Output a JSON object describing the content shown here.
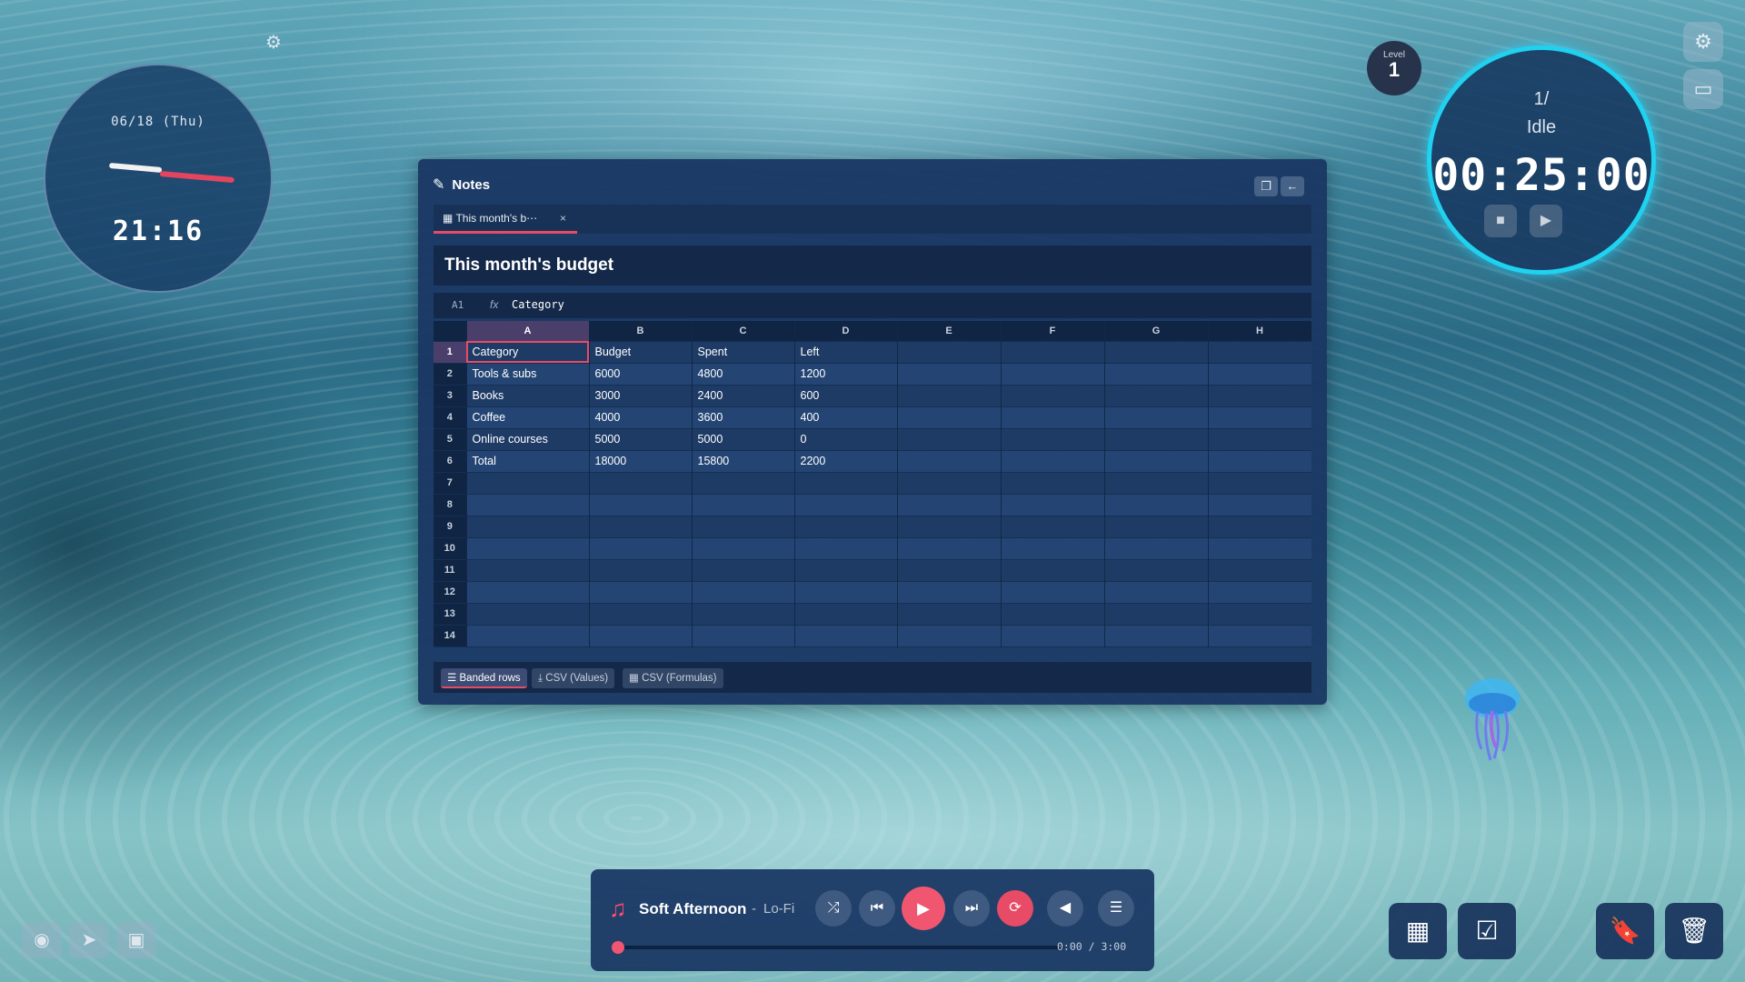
{
  "clock": {
    "date": "06/18 (Thu)",
    "time": "21:16"
  },
  "level": {
    "label": "Level",
    "value": "1"
  },
  "timer": {
    "count": "1/",
    "status": "Idle",
    "time": "00:25:00"
  },
  "notes": {
    "title": "Notes",
    "tab_label": "This month's b⋯",
    "tab_close": "×",
    "doc_title": "This month's budget",
    "formula_bar": {
      "cell_ref": "A1",
      "fx": "fx",
      "value": "Category"
    },
    "columns": [
      "A",
      "B",
      "C",
      "D",
      "E",
      "F",
      "G",
      "H"
    ],
    "rows": [
      {
        "num": "1",
        "cells": [
          "Category",
          "Budget",
          "Spent",
          "Left",
          "",
          "",
          "",
          ""
        ]
      },
      {
        "num": "2",
        "cells": [
          "Tools & subs",
          "6000",
          "4800",
          "1200",
          "",
          "",
          "",
          ""
        ]
      },
      {
        "num": "3",
        "cells": [
          "Books",
          "3000",
          "2400",
          "600",
          "",
          "",
          "",
          ""
        ]
      },
      {
        "num": "4",
        "cells": [
          "Coffee",
          "4000",
          "3600",
          "400",
          "",
          "",
          "",
          ""
        ]
      },
      {
        "num": "5",
        "cells": [
          "Online courses",
          "5000",
          "5000",
          "0",
          "",
          "",
          "",
          ""
        ]
      },
      {
        "num": "6",
        "cells": [
          "Total",
          "18000",
          "15800",
          "2200",
          "",
          "",
          "",
          ""
        ]
      },
      {
        "num": "7",
        "cells": [
          "",
          "",
          "",
          "",
          "",
          "",
          "",
          ""
        ]
      },
      {
        "num": "8",
        "cells": [
          "",
          "",
          "",
          "",
          "",
          "",
          "",
          ""
        ]
      },
      {
        "num": "9",
        "cells": [
          "",
          "",
          "",
          "",
          "",
          "",
          "",
          ""
        ]
      },
      {
        "num": "10",
        "cells": [
          "",
          "",
          "",
          "",
          "",
          "",
          "",
          ""
        ]
      },
      {
        "num": "11",
        "cells": [
          "",
          "",
          "",
          "",
          "",
          "",
          "",
          ""
        ]
      },
      {
        "num": "12",
        "cells": [
          "",
          "",
          "",
          "",
          "",
          "",
          "",
          ""
        ]
      },
      {
        "num": "13",
        "cells": [
          "",
          "",
          "",
          "",
          "",
          "",
          "",
          ""
        ]
      },
      {
        "num": "14",
        "cells": [
          "",
          "",
          "",
          "",
          "",
          "",
          "",
          ""
        ]
      }
    ],
    "footer": {
      "banded": "Banded rows",
      "csv_values": "CSV (Values)",
      "csv_formulas": "CSV (Formulas)"
    }
  },
  "player": {
    "title": "Soft Afternoon",
    "separator": "-",
    "genre": "Lo-Fi",
    "time": "0:00 / 3:00",
    "progress": 0
  },
  "colors": {
    "accent": "#e84b65",
    "timer_ring": "#1fd2f0",
    "panel": "#1a3864"
  },
  "icons": [
    "gear-icon",
    "pencil-icon",
    "copy-icon",
    "back-arrow-icon",
    "table-icon",
    "music-note-icon",
    "shuffle-icon",
    "previous-icon",
    "play-icon",
    "next-icon",
    "repeat-icon",
    "volume-icon",
    "playlist-icon",
    "eye-icon",
    "fish-icon",
    "image-icon",
    "calendar-icon",
    "checkbox-icon",
    "bookmark-icon",
    "trash-icon",
    "stop-icon",
    "card-icon"
  ]
}
